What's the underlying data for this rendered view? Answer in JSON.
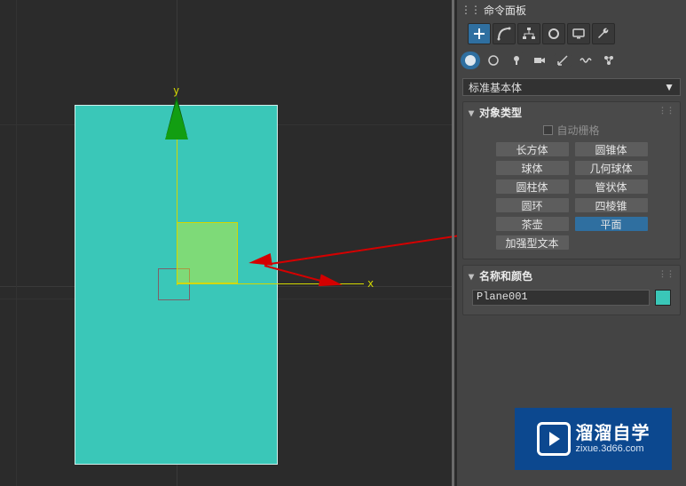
{
  "panel": {
    "title": "命令面板",
    "dropdown": "标准基本体"
  },
  "axes": {
    "x": "x",
    "y": "y"
  },
  "rollouts": {
    "objectType": {
      "title": "对象类型",
      "autoGrid": "自动栅格",
      "prims": [
        [
          "长方体",
          "圆锥体"
        ],
        [
          "球体",
          "几何球体"
        ],
        [
          "圆柱体",
          "管状体"
        ],
        [
          "圆环",
          "四棱锥"
        ],
        [
          "茶壶",
          "平面"
        ],
        [
          "加强型文本",
          ""
        ]
      ],
      "active": "平面"
    },
    "nameColor": {
      "title": "名称和颜色",
      "name": "Plane001",
      "color": "#3ac7b8"
    }
  },
  "watermark": {
    "main": "溜溜自学",
    "sub": "zixue.3d66.com"
  }
}
